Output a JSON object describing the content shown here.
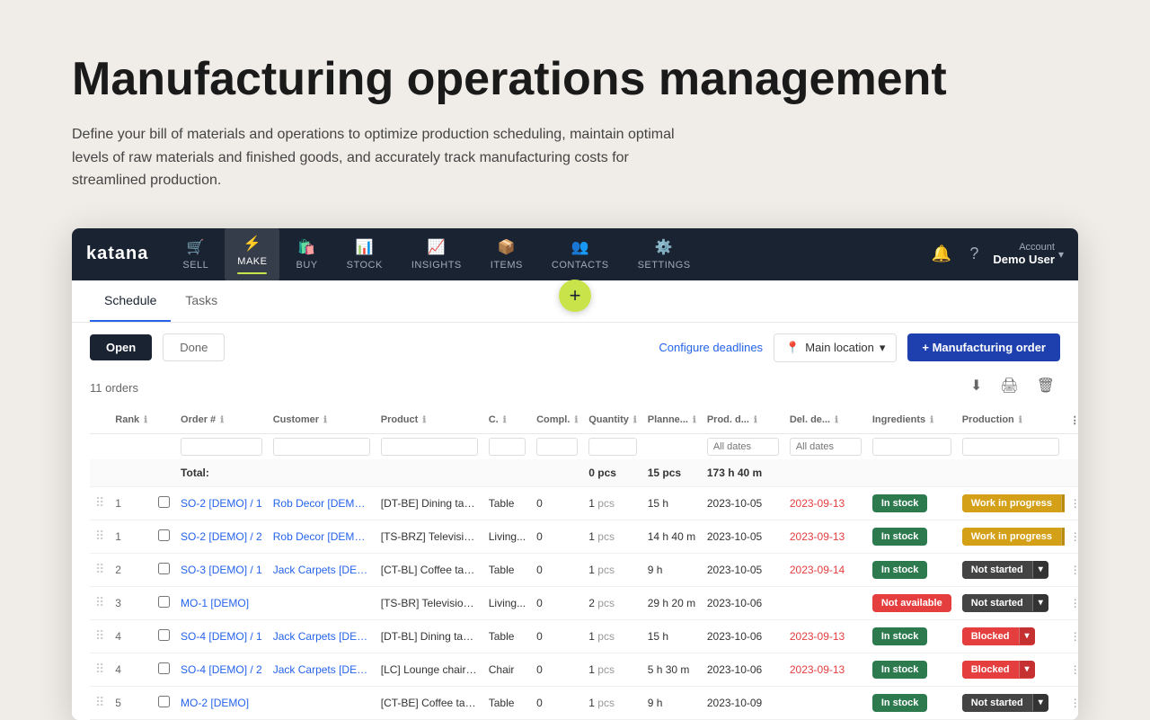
{
  "hero": {
    "title": "Manufacturing operations management",
    "description": "Define your bill of materials and operations to optimize production scheduling, maintain optimal levels of raw materials and finished goods, and accurately track manufacturing costs for streamlined production."
  },
  "nav": {
    "logo": "katana",
    "items": [
      {
        "id": "sell",
        "label": "SELL",
        "icon": "🛒",
        "active": false
      },
      {
        "id": "make",
        "label": "MAKE",
        "icon": "⚡",
        "active": true
      },
      {
        "id": "buy",
        "label": "BUY",
        "icon": "🛍️",
        "active": false
      },
      {
        "id": "stock",
        "label": "STOCK",
        "icon": "📊",
        "active": false
      },
      {
        "id": "insights",
        "label": "INSIGHTS",
        "icon": "📈",
        "active": false
      },
      {
        "id": "items",
        "label": "ITEMS",
        "icon": "📦",
        "active": false
      },
      {
        "id": "contacts",
        "label": "CONTACTS",
        "icon": "👥",
        "active": false
      },
      {
        "id": "settings",
        "label": "SETTINGS",
        "icon": "⚙️",
        "active": false
      }
    ],
    "account": {
      "label": "Account",
      "name": "Demo User"
    }
  },
  "tabs": [
    {
      "id": "schedule",
      "label": "Schedule",
      "active": true
    },
    {
      "id": "tasks",
      "label": "Tasks",
      "active": false
    }
  ],
  "toolbar": {
    "open_label": "Open",
    "done_label": "Done",
    "configure_deadlines_label": "Configure deadlines",
    "location_label": "Main location",
    "add_order_label": "+ Manufacturing order"
  },
  "table": {
    "orders_count": "11 orders",
    "columns": [
      "Rank",
      "Order #",
      "Customer",
      "Product",
      "C.",
      "Compl.",
      "Quantity",
      "Planne...",
      "Prod. d...",
      "Del. de...",
      "Ingredients",
      "Production"
    ],
    "total_row": {
      "quantity": "0",
      "quantity_unit": "pcs",
      "planned": "15",
      "planned_unit": "pcs",
      "time": "173 h 40 m"
    },
    "rows": [
      {
        "rank": "1",
        "order": "SO-2 [DEMO] / 1",
        "customer": "Rob Decor [DEMO] (S...",
        "product": "[DT-BE] Dining table [l...",
        "category": "Table",
        "compl": "0",
        "qty": "1",
        "qty_unit": "pcs",
        "planned": "15 h",
        "prod_date": "2023-10-05",
        "del_date": "2023-09-13",
        "del_date_red": true,
        "ingredients": "In stock",
        "ingredients_status": "green",
        "production": "Work in progress",
        "production_status": "wip"
      },
      {
        "rank": "1",
        "order": "SO-2 [DEMO] / 2",
        "customer": "Rob Decor [DEMO] (S...",
        "product": "[TS-BRZ] Television sta...",
        "category": "Living...",
        "compl": "0",
        "qty": "1",
        "qty_unit": "pcs",
        "planned": "14 h 40 m",
        "prod_date": "2023-10-05",
        "del_date": "2023-09-13",
        "del_date_red": true,
        "ingredients": "In stock",
        "ingredients_status": "green",
        "production": "Work in progress",
        "production_status": "wip"
      },
      {
        "rank": "2",
        "order": "SO-3 [DEMO] / 1",
        "customer": "Jack Carpets [DEMO] (...",
        "product": "[CT-BL] Coffee table [l...",
        "category": "Table",
        "compl": "0",
        "qty": "1",
        "qty_unit": "pcs",
        "planned": "9 h",
        "prod_date": "2023-10-05",
        "del_date": "2023-09-14",
        "del_date_red": true,
        "ingredients": "In stock",
        "ingredients_status": "green",
        "production": "Not started",
        "production_status": "not-started"
      },
      {
        "rank": "3",
        "order": "MO-1 [DEMO]",
        "customer": "",
        "product": "[TS-BR] Television sta...",
        "category": "Living...",
        "compl": "0",
        "qty": "2",
        "qty_unit": "pcs",
        "planned": "29 h 20 m",
        "prod_date": "2023-10-06",
        "del_date": "",
        "del_date_red": false,
        "ingredients": "Not available",
        "ingredients_status": "red",
        "production": "Not started",
        "production_status": "not-started"
      },
      {
        "rank": "4",
        "order": "SO-4 [DEMO] / 1",
        "customer": "Jack Carpets [DEMO] (...",
        "product": "[DT-BL] Dining table [l...",
        "category": "Table",
        "compl": "0",
        "qty": "1",
        "qty_unit": "pcs",
        "planned": "15 h",
        "prod_date": "2023-10-06",
        "del_date": "2023-09-13",
        "del_date_red": true,
        "ingredients": "In stock",
        "ingredients_status": "green",
        "production": "Blocked",
        "production_status": "blocked"
      },
      {
        "rank": "4",
        "order": "SO-4 [DEMO] / 2",
        "customer": "Jack Carpets [DEMO] (...",
        "product": "[LC] Lounge chair [DE...",
        "category": "Chair",
        "compl": "0",
        "qty": "1",
        "qty_unit": "pcs",
        "planned": "5 h 30 m",
        "prod_date": "2023-10-06",
        "del_date": "2023-09-13",
        "del_date_red": true,
        "ingredients": "In stock",
        "ingredients_status": "green",
        "production": "Blocked",
        "production_status": "blocked"
      },
      {
        "rank": "5",
        "order": "MO-2 [DEMO]",
        "customer": "",
        "product": "[CT-BE] Coffee table [l...",
        "category": "Table",
        "compl": "0",
        "qty": "1",
        "qty_unit": "pcs",
        "planned": "9 h",
        "prod_date": "2023-10-09",
        "del_date": "",
        "del_date_red": false,
        "ingredients": "In stock",
        "ingredients_status": "green",
        "production": "Not started",
        "production_status": "not-started"
      }
    ]
  }
}
